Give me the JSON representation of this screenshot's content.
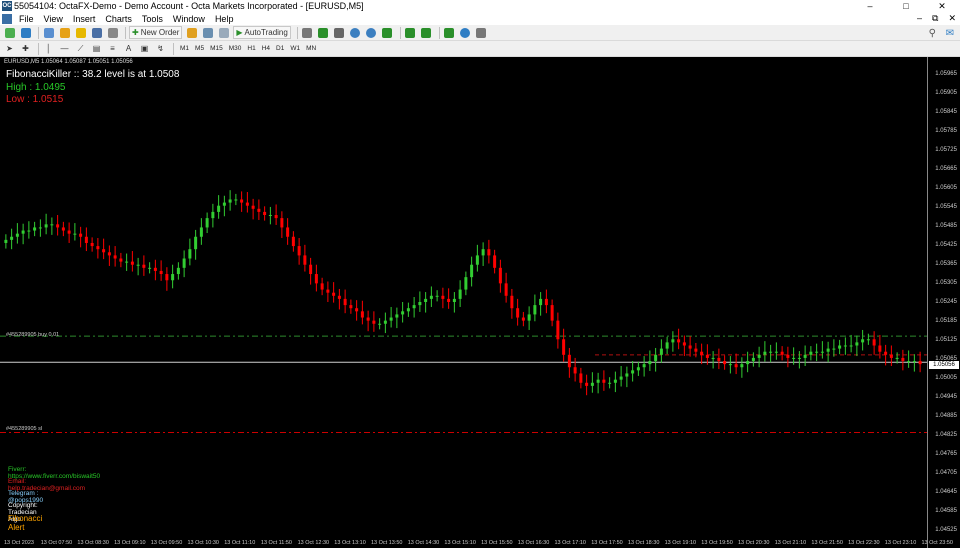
{
  "window": {
    "title": "55054104: OctaFX-Demo - Demo Account - Octa Markets Incorporated - [EURUSD,M5]",
    "app_icon": "OC"
  },
  "menu": [
    "File",
    "View",
    "Insert",
    "Charts",
    "Tools",
    "Window",
    "Help"
  ],
  "toolbar": {
    "new_order": "New Order",
    "autotrading": "AutoTrading",
    "timeframes": [
      "M1",
      "M5",
      "M15",
      "M30",
      "H1",
      "H4",
      "D1",
      "W1",
      "MN"
    ]
  },
  "chart": {
    "header": "EURUSD,M5   1.05064 1.05087 1.05051 1.05056",
    "indicator": {
      "title": "FibonacciKiller  :: 38.2 level is at 1.0508",
      "high": "High   :  1.0495",
      "low": "Low   :  1.0515"
    },
    "buy_label": "#455289905 buy 0.01",
    "sl_label": "#455289905 sl",
    "current_price": "1.05056",
    "notes": [
      {
        "text": "Fiverr: https://www.fiverr.com/biswait50",
        "color": "#28c828"
      },
      {
        "text": "Email: help.tradecian@gmail.com",
        "color": "#e02020"
      },
      {
        "text": "Telegram : @pops1990",
        "color": "#87cefa"
      },
      {
        "text": "Copyright: Tradecian Algo",
        "color": "#ffffff"
      },
      {
        "text": "Fibonacci Alert",
        "color": "#ffa500"
      }
    ],
    "price_ticks": [
      "1.05965",
      "1.05905",
      "1.05845",
      "1.05785",
      "1.05725",
      "1.05665",
      "1.05605",
      "1.05545",
      "1.05485",
      "1.05425",
      "1.05365",
      "1.05305",
      "1.05245",
      "1.05185",
      "1.05125",
      "1.05065",
      "1.05005",
      "1.04945",
      "1.04885",
      "1.04825",
      "1.04765",
      "1.04705",
      "1.04645",
      "1.04585",
      "1.04525"
    ],
    "time_ticks": [
      "13 Oct 2023",
      "13 Oct 07:50",
      "13 Oct 08:30",
      "13 Oct 09:10",
      "13 Oct 09:50",
      "13 Oct 10:30",
      "13 Oct 11:10",
      "13 Oct 11:50",
      "13 Oct 12:30",
      "13 Oct 13:10",
      "13 Oct 13:50",
      "13 Oct 14:30",
      "13 Oct 15:10",
      "13 Oct 15:50",
      "13 Oct 16:30",
      "13 Oct 17:10",
      "13 Oct 17:50",
      "13 Oct 18:30",
      "13 Oct 19:10",
      "13 Oct 19:50",
      "13 Oct 20:30",
      "13 Oct 21:10",
      "13 Oct 21:50",
      "13 Oct 22:30",
      "13 Oct 23:10",
      "13 Oct 23:50"
    ],
    "colors": {
      "bull": "#32cd32",
      "bear": "#ff0000",
      "buy_line": "#2e8b2e",
      "sl_line": "#cc0000",
      "price_line": "#d0d0d0"
    }
  },
  "chart_data": {
    "type": "candlestick",
    "symbol": "EURUSD",
    "timeframe": "M5",
    "price_range": [
      1.045,
      1.06
    ],
    "levels": {
      "buy": 1.0514,
      "sl": 1.0483,
      "current": 1.05056,
      "high_dash": 1.0508
    },
    "close_series": [
      1.0545,
      1.0546,
      1.0547,
      1.0548,
      1.0548,
      1.0549,
      1.0549,
      1.055,
      1.055,
      1.0549,
      1.0548,
      1.0547,
      1.0547,
      1.0546,
      1.0544,
      1.0543,
      1.0542,
      1.0541,
      1.054,
      1.0539,
      1.0538,
      1.0538,
      1.0537,
      1.0537,
      1.0536,
      1.0536,
      1.0535,
      1.0534,
      1.0532,
      1.0534,
      1.0536,
      1.0539,
      1.0542,
      1.0546,
      1.0549,
      1.0552,
      1.0554,
      1.0556,
      1.0557,
      1.0558,
      1.0558,
      1.0557,
      1.0556,
      1.0555,
      1.0554,
      1.0553,
      1.0553,
      1.0552,
      1.0549,
      1.0546,
      1.0543,
      1.054,
      1.0537,
      1.0534,
      1.0531,
      1.0529,
      1.0528,
      1.0527,
      1.0526,
      1.0524,
      1.0523,
      1.0522,
      1.052,
      1.0519,
      1.0518,
      1.0518,
      1.0519,
      1.052,
      1.0521,
      1.0522,
      1.0523,
      1.0524,
      1.0525,
      1.0526,
      1.0527,
      1.0527,
      1.0526,
      1.0525,
      1.0526,
      1.0529,
      1.0533,
      1.0537,
      1.054,
      1.0542,
      1.054,
      1.0536,
      1.0531,
      1.0527,
      1.0523,
      1.052,
      1.0519,
      1.0521,
      1.0524,
      1.0526,
      1.0524,
      1.0519,
      1.0513,
      1.0508,
      1.0504,
      1.0502,
      1.0499,
      1.0498,
      1.0499,
      1.05,
      1.0499,
      1.0499,
      1.05,
      1.0501,
      1.0502,
      1.0503,
      1.0504,
      1.0505,
      1.0506,
      1.0508,
      1.051,
      1.0512,
      1.0513,
      1.0512,
      1.0511,
      1.051,
      1.0509,
      1.0508,
      1.0507,
      1.0507,
      1.0506,
      1.0505,
      1.0505,
      1.0504,
      1.0505,
      1.0506,
      1.0507,
      1.0508,
      1.0509,
      1.0509,
      1.0509,
      1.0508,
      1.0507,
      1.0507,
      1.0507,
      1.0508,
      1.0509,
      1.0509,
      1.0509,
      1.051,
      1.051,
      1.0511,
      1.0511,
      1.0511,
      1.0512,
      1.0513,
      1.0513,
      1.0511,
      1.0509,
      1.0508,
      1.0507,
      1.0507,
      1.0506,
      1.0506,
      1.0506,
      1.0505
    ]
  }
}
